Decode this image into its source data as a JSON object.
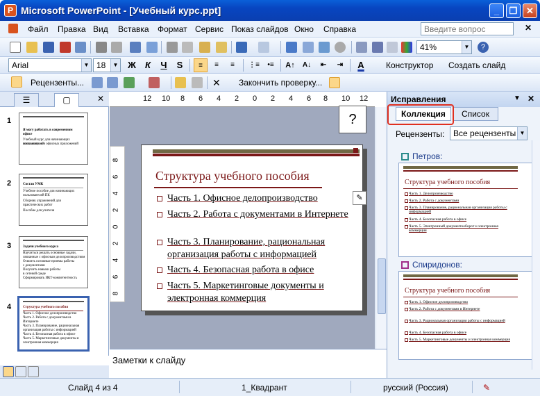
{
  "window": {
    "title": "Microsoft PowerPoint - [Учебный курс.ppt]"
  },
  "menu": {
    "items": [
      "Файл",
      "Правка",
      "Вид",
      "Вставка",
      "Формат",
      "Сервис",
      "Показ слайдов",
      "Окно",
      "Справка"
    ],
    "help_placeholder": "Введите вопрос"
  },
  "standard_toolbar": {
    "zoom": "41%"
  },
  "formatting_toolbar": {
    "font": "Arial",
    "size": "18",
    "bold": "Ж",
    "italic": "К",
    "underline": "Ч",
    "shadow": "S",
    "designer": "Конструктор",
    "new_slide": "Создать слайд"
  },
  "review_toolbar": {
    "reviewers": "Рецензенты...",
    "end_review": "Закончить проверку..."
  },
  "left_pane": {
    "thumbnails": [
      {
        "num": "1",
        "title": "Я могу работать в современном офисе",
        "lines": [
          "Учебный курс для начинающих пользователей",
          "компьютеров и офисных приложений"
        ]
      },
      {
        "num": "2",
        "title": "Состав УМК",
        "lines": [
          "Учебное пособие для начинающих",
          "пользователей ПК",
          "Сборник упражнений для",
          "практических работ",
          "Пособие для учителя"
        ]
      },
      {
        "num": "3",
        "title": "Задачи учебного курса",
        "lines": [
          "Научиться решать основные задачи,",
          "связанные с офисным делопроизводством",
          "Освоить основные приемы работы",
          "с документами",
          "Получить навыки работы",
          "в сетевой среде",
          "Сформировать ИКТ-компетентность"
        ]
      },
      {
        "num": "4",
        "title": "Структура учебного пособия",
        "lines": [
          "Часть 1. Офисное делопроизводство",
          "Часть 2. Работа с документами в",
          "Интернете",
          "Часть 3. Планирование, рациональная",
          "организация работы с информацией",
          "Часть 4. Безопасная работа в офисе",
          "Часть 5. Маркетинговые документы и",
          "электронная коммерция"
        ]
      }
    ]
  },
  "ruler": {
    "h_ticks": [
      "12",
      "10",
      "8",
      "6",
      "4",
      "2",
      "0",
      "2",
      "4",
      "6",
      "8",
      "10",
      "12"
    ],
    "v_ticks": [
      "8",
      "6",
      "4",
      "2",
      "0",
      "2",
      "4",
      "6",
      "8"
    ]
  },
  "slide": {
    "title": "Структура учебного пособия",
    "items": [
      "Часть 1. Офисное делопроизводство",
      "Часть 2. Работа с документами в Интернете",
      "Часть 3. Планирование, рациональная организация работы с информацией",
      "Часть 4. Безопасная работа в офисе",
      "Часть 5. Маркетинговые документы и электронная коммерция"
    ]
  },
  "notes": {
    "placeholder": "Заметки к слайду"
  },
  "task_pane": {
    "title": "Исправления",
    "tabs": [
      "Коллекция",
      "Список"
    ],
    "reviewers_label": "Рецензенты:",
    "reviewers_value": "Все рецензенты",
    "reviewer_colors": {
      "petrov": "#2a8a8a",
      "spiridonov": "#a0308a"
    },
    "reviewers": [
      {
        "name": "Петров:",
        "slide_title": "Структура учебного пособия",
        "items": [
          "Часть 1. Делопроизводство",
          "Часть 2. Работа с документами",
          "Часть 3. Планирование, рациональная организация работы с информацией",
          "Часть 4. Безопасная работа в офисе",
          "Часть 5. Электронный документооборот и электронная коммерция"
        ]
      },
      {
        "name": "Спиридонов:",
        "slide_title": "Структура учебного пособия",
        "items": [
          "Часть 1. Офисное делопроизводство",
          "Часть 2. Работа с документами в Интернете",
          "Часть 3. Рациональная организация работы с информацией",
          "Часть 4. Безопасная работа в офисе",
          "Часть 5. Маркетинговые документы и электронная коммерция"
        ]
      }
    ]
  },
  "callout": {
    "text": "?"
  },
  "status": {
    "slide": "Слайд 4 из 4",
    "design": "1_Квадрант",
    "language": "русский (Россия)"
  }
}
